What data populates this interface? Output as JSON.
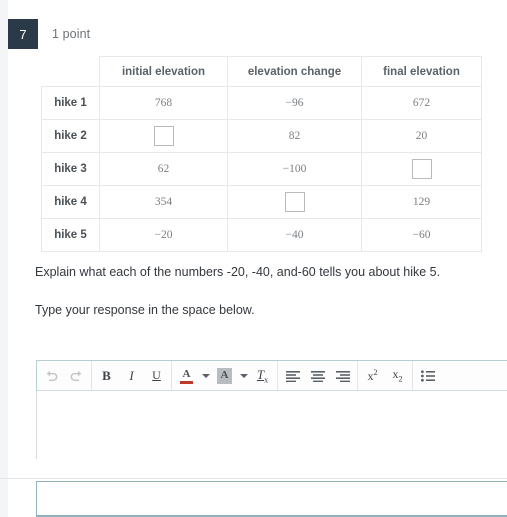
{
  "question": {
    "number": "7",
    "points_label": "1 point"
  },
  "table": {
    "headers": [
      "",
      "initial elevation",
      "elevation change",
      "final elevation"
    ],
    "rows": [
      {
        "label": "hike 1",
        "initial_elevation": "768",
        "elevation_change": "−96",
        "final_elevation": "672"
      },
      {
        "label": "hike 2",
        "initial_elevation": "",
        "elevation_change": "82",
        "final_elevation": "20"
      },
      {
        "label": "hike 3",
        "initial_elevation": "62",
        "elevation_change": "−100",
        "final_elevation": ""
      },
      {
        "label": "hike 4",
        "initial_elevation": "354",
        "elevation_change": "",
        "final_elevation": "129"
      },
      {
        "label": "hike 5",
        "initial_elevation": "−20",
        "elevation_change": "−40",
        "final_elevation": "−60"
      }
    ]
  },
  "prompts": {
    "line1": "Explain what each of the numbers -20, -40, and-60 tells you about hike 5.",
    "line2": "Type your response in the space below."
  },
  "editor": {
    "toolbar": [
      {
        "name": "undo-icon",
        "label": "Undo"
      },
      {
        "name": "redo-icon",
        "label": "Redo"
      },
      {
        "name": "bold-icon",
        "label": "B"
      },
      {
        "name": "italic-icon",
        "label": "I"
      },
      {
        "name": "underline-icon",
        "label": "U"
      },
      {
        "name": "text-color-icon",
        "label": "A"
      },
      {
        "name": "highlight-color-icon",
        "label": "A"
      },
      {
        "name": "remove-format-icon",
        "label": "Tx"
      },
      {
        "name": "align-left-icon",
        "label": "Align left"
      },
      {
        "name": "align-center-icon",
        "label": "Align center"
      },
      {
        "name": "align-right-icon",
        "label": "Align right"
      },
      {
        "name": "superscript-icon",
        "label": "x2"
      },
      {
        "name": "subscript-icon",
        "label": "x2"
      },
      {
        "name": "bullet-list-icon",
        "label": "Bullet list"
      }
    ],
    "response_value": "",
    "response_placeholder": ""
  },
  "colors": {
    "question_badge": "#2b3a48",
    "text_color_swatch": "#c0392b",
    "highlight_swatch": "#b9bcbf",
    "editor_border": "#b6cdd6",
    "answer_box_border": "#8fb2bd"
  }
}
